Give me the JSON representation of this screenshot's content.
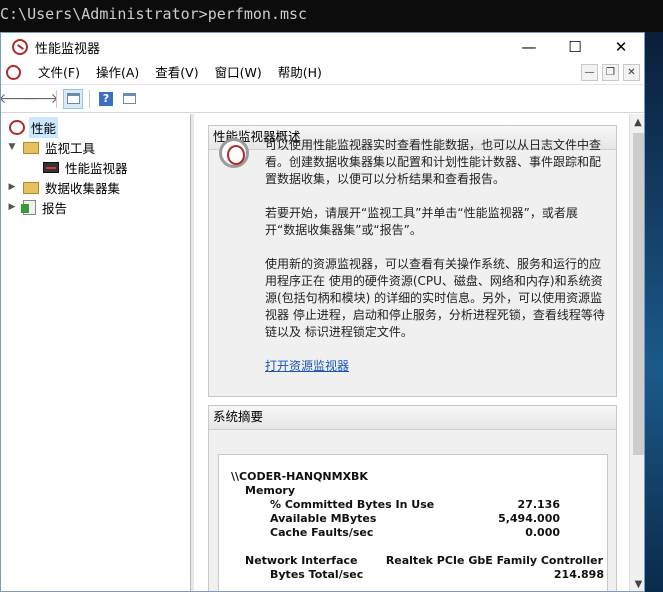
{
  "console": {
    "command": "C:\\Users\\Administrator>perfmon.msc"
  },
  "window": {
    "title": "性能监视器",
    "minimize": "—",
    "maximize": "☐",
    "close": "✕"
  },
  "menu": {
    "items": [
      "文件(F)",
      "操作(A)",
      "查看(V)",
      "窗口(W)",
      "帮助(H)"
    ]
  },
  "toolbar": {
    "back": "🡐",
    "forward": "🡒",
    "help": "?"
  },
  "tree": {
    "root": "性能",
    "monitor_tools": "监视工具",
    "perf_monitor": "性能监视器",
    "data_collector_sets": "数据收集器集",
    "reports": "报告"
  },
  "overview": {
    "heading": "性能监视器概述",
    "p1": "可以使用性能监视器实时查看性能数据，也可以从日志文件中查看。创建数据收集器集以配置和计划性能计数器、事件跟踪和配置数据收集，以便可以分析结果和查看报告。",
    "p2": "若要开始，请展开“监视工具”并单击“性能监视器”，或者展开“数据收集器集”或“报告”。",
    "p3": "使用新的资源监视器，可以查看有关操作系统、服务和运行的应用程序正在 使用的硬件资源(CPU、磁盘、网络和内存)和系统资源(包括句柄和模块) 的详细的实时信息。另外，可以使用资源监视器 停止进程，启动和停止服务，分析进程死锁，查看线程等待链以及 标识进程锁定文件。",
    "link": "打开资源监视器"
  },
  "summary": {
    "heading": "系统摘要",
    "host": "\\\\CODER-HANQNMXBK",
    "memory": "Memory",
    "committed": "% Committed Bytes In Use",
    "committed_val": "27.136",
    "available": "Available MBytes",
    "available_val": "5,494.000",
    "cache": "Cache Faults/sec",
    "cache_val": "0.000",
    "net": "Network Interface",
    "net_val": "Realtek PCIe GbE Family Controller",
    "bytes": "Bytes Total/sec",
    "bytes_val": "214.898"
  }
}
